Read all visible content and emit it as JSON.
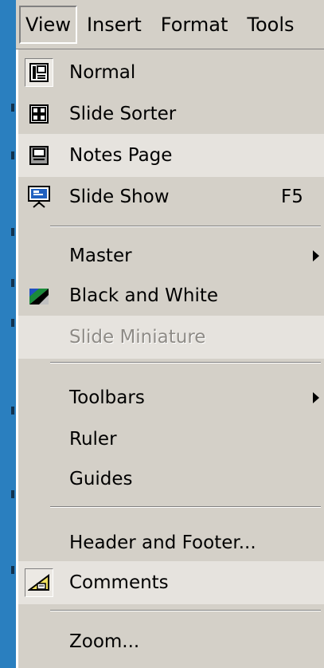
{
  "menubar": {
    "items": [
      {
        "label": "View"
      },
      {
        "label": "Insert"
      },
      {
        "label": "Format"
      },
      {
        "label": "Tools"
      }
    ]
  },
  "menu": {
    "items": [
      {
        "label": "Normal",
        "icon": "normal-view-icon"
      },
      {
        "label": "Slide Sorter",
        "icon": "slide-sorter-icon"
      },
      {
        "label": "Notes Page",
        "icon": "notes-page-icon"
      },
      {
        "label": "Slide Show",
        "icon": "slide-show-icon",
        "shortcut": "F5"
      },
      {
        "label": "Master",
        "has_submenu": true
      },
      {
        "label": "Black and White",
        "icon": "black-and-white-icon"
      },
      {
        "label": "Slide Miniature",
        "disabled": true
      },
      {
        "label": "Toolbars",
        "has_submenu": true
      },
      {
        "label": "Ruler"
      },
      {
        "label": "Guides"
      },
      {
        "label": "Header and Footer..."
      },
      {
        "label": "Comments",
        "icon": "comments-icon",
        "checked": true
      },
      {
        "label": "Zoom..."
      }
    ]
  },
  "colors": {
    "menu_bg": "#d4d0c8",
    "desktop_blue": "#2a7fbf",
    "disabled_text": "#8e8b86"
  }
}
